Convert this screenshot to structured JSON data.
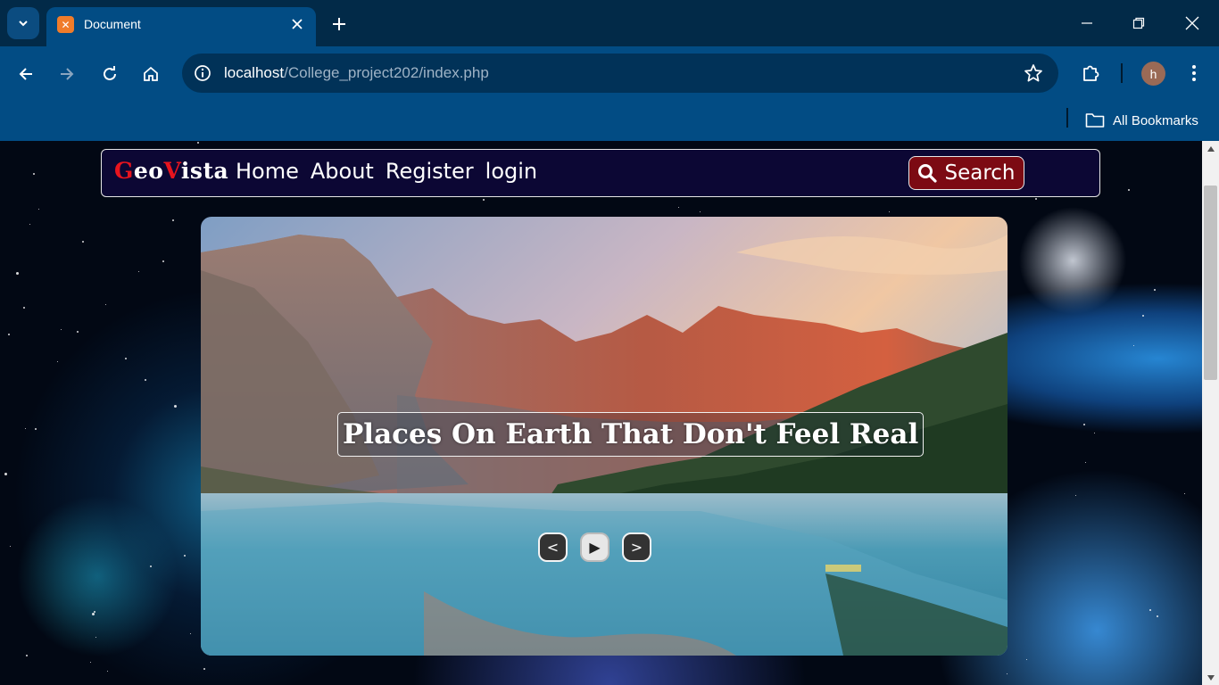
{
  "browser": {
    "tab_title": "Document",
    "url_host": "localhost",
    "url_path": "/College_project202/index.php",
    "bookmarks_label": "All Bookmarks",
    "profile_initial": "h",
    "favicon_glyph": "ꞏ"
  },
  "site": {
    "logo_parts": [
      "G",
      "eo",
      "V",
      "ista"
    ],
    "nav": [
      "Home",
      "About",
      "Register",
      "login"
    ],
    "search_label": "Search",
    "colors": {
      "nav_bg": "#0c0734",
      "logo_red": "#e8141e",
      "search_bg": "#7c0a13"
    }
  },
  "hero": {
    "caption": "Places On Earth That Don't Feel Real",
    "controls": {
      "prev": "<",
      "play": "▶",
      "next": ">"
    }
  }
}
